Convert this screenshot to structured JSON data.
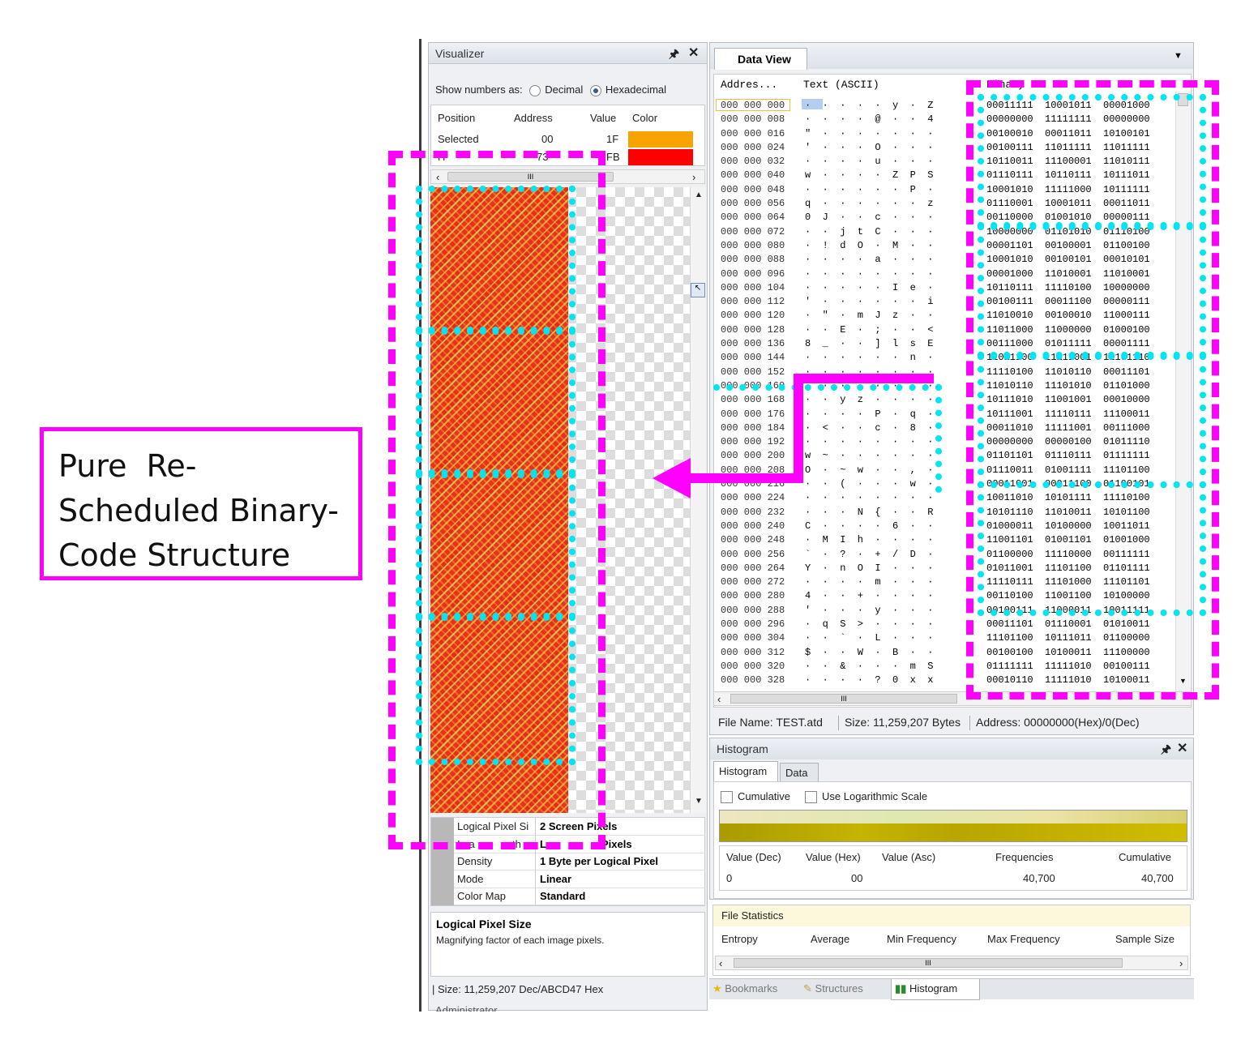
{
  "annotation": {
    "label": "Pure  Re-Scheduled Binary-Code Structure",
    "colors": {
      "magenta": "#ff00ff",
      "cyan": "#00e5ee"
    }
  },
  "visualizer": {
    "title": "Visualizer",
    "show_numbers": {
      "label": "Show numbers as:",
      "options": [
        "Decimal",
        "Hexadecimal"
      ],
      "selected": "Hexadecimal"
    },
    "table": {
      "headers": [
        "Position",
        "Address",
        "Value",
        "Color"
      ],
      "rows": [
        {
          "position": "Selected",
          "address": "00",
          "value": "1F",
          "color": "#f7a400"
        },
        {
          "position": "H",
          "address": "73",
          "value": "FB",
          "color": "#ff0000"
        }
      ]
    },
    "scroll_label": "III",
    "properties": [
      {
        "name": "Logical Pixel Si",
        "value": "2 Screen Pixels"
      },
      {
        "name": "Ima",
        "value": "Lo",
        "name_tail": "th",
        "value_tail": "Pixels"
      },
      {
        "name": "Density",
        "value": "1 Byte per Logical Pixel"
      },
      {
        "name": "Mode",
        "value": "Linear"
      },
      {
        "name": "Color Map",
        "value": "Standard"
      }
    ],
    "desc_title": "Logical Pixel Size",
    "desc_text": "Magnifying factor of each image pixels.",
    "status": "| Size: 11,259,207 Dec/ABCD47 Hex",
    "bottom_text": "Administrator"
  },
  "data_view": {
    "tab": "Data View",
    "headers": {
      "address": "Addres...",
      "text": "Text (ASCII)",
      "binary": "Binary"
    },
    "rows": [
      {
        "a": "000 000 000",
        "t": "·  ·  ·  ·  ·  y  ·  Z",
        "b": "00011111  10001011  00001000"
      },
      {
        "a": "000 000 008",
        "t": "·  ·  ·  ·  @  ·  ·  4",
        "b": "00000000  11111111  00000000"
      },
      {
        "a": "000 000 016",
        "t": "\"  ·  ·  ·  ·  ·  ·  ·",
        "b": "00100010  00011011  10100101"
      },
      {
        "a": "000 000 024",
        "t": "'  ·  ·  ·  O  ·  ·  ·",
        "b": "00100111  11011111  11011111"
      },
      {
        "a": "000 000 032",
        "t": "·  ·  ·  ·  u  ·  ·  ·",
        "b": "10110011  11100001  11010111"
      },
      {
        "a": "000 000 040",
        "t": "w  ·  ·  ·  ·  Z  P  S",
        "b": "01110111  10110111  10111011"
      },
      {
        "a": "000 000 048",
        "t": "·  ·  ·  ·  ·  ·  P  ·",
        "b": "10001010  11111000  10111111"
      },
      {
        "a": "000 000 056",
        "t": "q  ·  ·  ·  ·  ·  ·  z",
        "b": "01110001  10001011  00011011"
      },
      {
        "a": "000 000 064",
        "t": "0  J  ·  ·  c  ·  ·  ·",
        "b": "00110000  01001010  00000111"
      },
      {
        "a": "000 000 072",
        "t": "·  ·  j  t  C  ·  ·  ·",
        "b": "10000000  01101010  01110100"
      },
      {
        "a": "000 000 080",
        "t": "·  !  d  O  ·  M  ·  ·",
        "b": "00001101  00100001  01100100"
      },
      {
        "a": "000 000 088",
        "t": "·  ·  ·  ·  a  ·  ·  ·",
        "b": "10001010  00100101  00010101"
      },
      {
        "a": "000 000 096",
        "t": "·  ·  ·  ·  ·  ·  ·  ·",
        "b": "00001000  11010001  11010001"
      },
      {
        "a": "000 000 104",
        "t": "·  ·  ·  ·  ·  I  e  ·",
        "b": "10110111  11110100  10000000"
      },
      {
        "a": "000 000 112",
        "t": "'  ·  ·  ·  ·  ·  ·  i",
        "b": "00100111  00011100  00000111"
      },
      {
        "a": "000 000 120",
        "t": "·  \"  ·  m  J  z  ·  ·",
        "b": "11010010  00100010  11000111"
      },
      {
        "a": "000 000 128",
        "t": "·  ·  E  ·  ;  ·  ·  <",
        "b": "11011000  11000000  01000100"
      },
      {
        "a": "000 000 136",
        "t": "8  _  ·  ·  ]  l  s  E",
        "b": "00111000  01011111  00001111"
      },
      {
        "a": "000 000 144",
        "t": "·  ·  ·  ·  ·  ·  n  ·",
        "b": "11011100  11111001  11101110"
      },
      {
        "a": "000 000 152",
        "t": "·  ·  ·  ·  ·  ·  ·  ·",
        "b": "11110100  11010110  00011101"
      },
      {
        "a": "000 000 160",
        "t": "·  ·  ·  ·  ·  ·  ·  ·",
        "b": "11010110  11101010  01101000"
      },
      {
        "a": "000 000 168",
        "t": "·  ·  y  z  ·  ·  ·  ·",
        "b": "10111010  11001001  00010000"
      },
      {
        "a": "000 000 176",
        "t": "·  ·  ·  ·  P  ·  q  ·",
        "b": "10111001  11110111  11100011"
      },
      {
        "a": "000 000 184",
        "t": "·  <  ·  ·  c  ·  8  ·",
        "b": "00011010  11111001  00111000"
      },
      {
        "a": "000 000 192",
        "t": "·  ·  ·  ·  ·  ·  ·  ·",
        "b": "00000000  00000100  01011110"
      },
      {
        "a": "000 000 200",
        "t": "w  ~  ·  ·  ·  ·  ·  ·",
        "b": "01101101  01110111  01111111"
      },
      {
        "a": "000 000 208",
        "t": "O  ·  ~  w  ·  ·  ,  ·",
        "b": "01110011  01001111  11101100"
      },
      {
        "a": "000 000 216",
        "t": "·  ·  (  ·  ·  ·  w  ·",
        "b": "00011001  00011100  01100101"
      },
      {
        "a": "000 000 224",
        "t": "·  ·  ·  ·  ·  ·  ·  ·",
        "b": "10011010  10101111  11110100"
      },
      {
        "a": "000 000 232",
        "t": "·  ·  ·  N  {  ·  ·  R",
        "b": "10101110  11010011  10101100"
      },
      {
        "a": "000 000 240",
        "t": "C  ·  ·  ·  ·  6  ·  ·",
        "b": "01000011  10100000  10011011"
      },
      {
        "a": "000 000 248",
        "t": "·  M  I  h  ·  ·  ·  ·",
        "b": "11001101  01001101  01001000"
      },
      {
        "a": "000 000 256",
        "t": "`  ·  ?  ·  +  /  D  ·",
        "b": "01100000  11110000  00111111"
      },
      {
        "a": "000 000 264",
        "t": "Y  ·  n  O  I  ·  ·  ·",
        "b": "01011001  11101100  01101111"
      },
      {
        "a": "000 000 272",
        "t": "·  ·  ·  ·  m  ·  ·  ·",
        "b": "11110111  11101000  11101101"
      },
      {
        "a": "000 000 280",
        "t": "4  ·  ·  +  ·  ·  ·  ·",
        "b": "00110100  11001100  10100000"
      },
      {
        "a": "000 000 288",
        "t": "'  ·  ·  ·  y  ·  ·  ·",
        "b": "00100111  11000011  10011111"
      },
      {
        "a": "000 000 296",
        "t": "·  q  S  >  ·  ·  ·  ·",
        "b": "00011101  01110001  01010011"
      },
      {
        "a": "000 000 304",
        "t": "·  ·  `  ·  L  ·  ·  ·",
        "b": "11101100  10111011  01100000"
      },
      {
        "a": "000 000 312",
        "t": "$  ·  ·  W  ·  B  ·  ·",
        "b": "00100100  10100011  11100000"
      },
      {
        "a": "000 000 320",
        "t": "·  ·  &  ·  ·  ·  m  S",
        "b": "01111111  11111010  00100111"
      },
      {
        "a": "000 000 328",
        "t": "·  ·  ·  ·  ?  0  x  x",
        "b": "00010110  11111010  10100011"
      }
    ],
    "scroll_label": "III",
    "status": {
      "file": "File Name: TEST.atd",
      "size": "Size: 11,259,207 Bytes",
      "address": "Address: 00000000(Hex)/0(Dec)"
    }
  },
  "histogram": {
    "title": "Histogram",
    "tabs": [
      "Histogram",
      "Data"
    ],
    "options": [
      "Cumulative",
      "Use Logarithmic Scale"
    ],
    "table": {
      "headers": [
        "Value (Dec)",
        "Value (Hex)",
        "Value (Asc)",
        "Frequencies",
        "Cumulative"
      ],
      "rows": [
        {
          "dec": "0",
          "hex": "00",
          "asc": "",
          "freq": "40,700",
          "cum": "40,700"
        }
      ]
    },
    "bar_color": "#c8b800"
  },
  "file_stats": {
    "title": "File Statistics",
    "headers": [
      "Entropy",
      "Average",
      "Min Frequency",
      "Max  Frequency",
      "Sample Size"
    ],
    "scroll_label": "III"
  },
  "bottom_tabs": [
    "Bookmarks",
    "Structures",
    "Histogram"
  ]
}
